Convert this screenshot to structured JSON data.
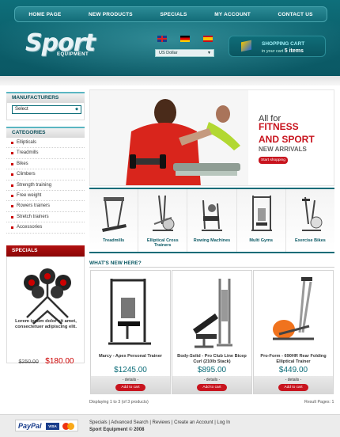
{
  "nav": {
    "items": [
      "HOME PAGE",
      "NEW PRODUCTS",
      "SPECIALS",
      "MY ACCOUNT",
      "CONTACT US"
    ]
  },
  "logo": {
    "main": "Sport",
    "sub": "EQUIPMENT"
  },
  "currency": {
    "selected": "US Dollar"
  },
  "cart": {
    "title": "SHOPPING CART",
    "prefix": "in your cart",
    "count": "5 items"
  },
  "sidebar": {
    "manufacturers": {
      "title": "MANUFACTURERS",
      "select_value": "Select"
    },
    "categories": {
      "title": "CATEGORIES",
      "items": [
        "Ellipticals",
        "Treadmills",
        "Bikes",
        "Climbers",
        "Strength training",
        "Free weight",
        "Rowers trainers",
        "Stretch trainers",
        "Accessories"
      ]
    },
    "specials": {
      "title": "SPECIALS",
      "description": "Lorem ipsum dolor sit amet, consectetuer adipiscing elit.",
      "old_price": "$250.00",
      "new_price": "$180.00"
    }
  },
  "banner": {
    "line1": "All for",
    "line2": "FITNESS",
    "line3": "AND SPORT",
    "line4": "NEW ARRIVALS",
    "button": "Start shopping"
  },
  "strip": [
    "Treadmills",
    "Elliptical Cross Trainers",
    "Rowing Machines",
    "Multi Gyms",
    "Exercise Bikes"
  ],
  "whats_new": {
    "title": "WHAT'S NEW HERE?",
    "products": [
      {
        "name": "Marcy - Apex Personal Trainer",
        "price": "$1245.00",
        "details": "- details -",
        "button": "Add to cart"
      },
      {
        "name": "Body-Solid - Pro Club Line Bicep Curl (210lb Stack)",
        "price": "$895.00",
        "details": "- details -",
        "button": "Add to cart"
      },
      {
        "name": "Pro-Form - 690HR Rear Folding Elliptical Trainer",
        "price": "$449.00",
        "details": "- details -",
        "button": "Add to cart"
      }
    ],
    "displaying": "Displaying 1 to 3 (of 3 products)",
    "result_pages": "Result Pages: 1"
  },
  "footer": {
    "payment": {
      "paypal": "PayPal",
      "visa": "VISA"
    },
    "links": [
      "Specials",
      "Advanced Search",
      "Reviews",
      "Create an Account",
      "Log In"
    ],
    "copyright": "Sport Equipment  © 2008"
  },
  "colors": {
    "teal": "#0b6c78",
    "red": "#c8141e"
  }
}
